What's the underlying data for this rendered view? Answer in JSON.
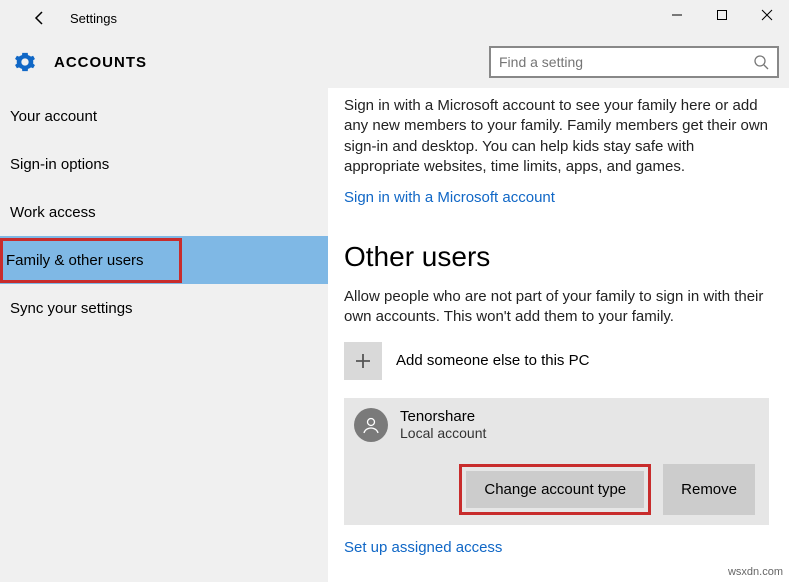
{
  "window": {
    "title": "Settings"
  },
  "header": {
    "section": "ACCOUNTS"
  },
  "search": {
    "placeholder": "Find a setting"
  },
  "sidebar": {
    "items": [
      {
        "label": "Your account"
      },
      {
        "label": "Sign-in options"
      },
      {
        "label": "Work access"
      },
      {
        "label": "Family & other users"
      },
      {
        "label": "Sync your settings"
      }
    ]
  },
  "content": {
    "intro": "Sign in with a Microsoft account to see your family here or add any new members to your family. Family members get their own sign-in and desktop. You can help kids stay safe with appropriate websites, time limits, apps, and games.",
    "signin_link": "Sign in with a Microsoft account",
    "other_users_heading": "Other users",
    "other_users_para": "Allow people who are not part of your family to sign in with their own accounts. This won't add them to your family.",
    "add_label": "Add someone else to this PC",
    "user": {
      "name": "Tenorshare",
      "type": "Local account"
    },
    "change_btn": "Change account type",
    "remove_btn": "Remove",
    "assigned_link": "Set up assigned access"
  },
  "watermark": "wsxdn.com"
}
